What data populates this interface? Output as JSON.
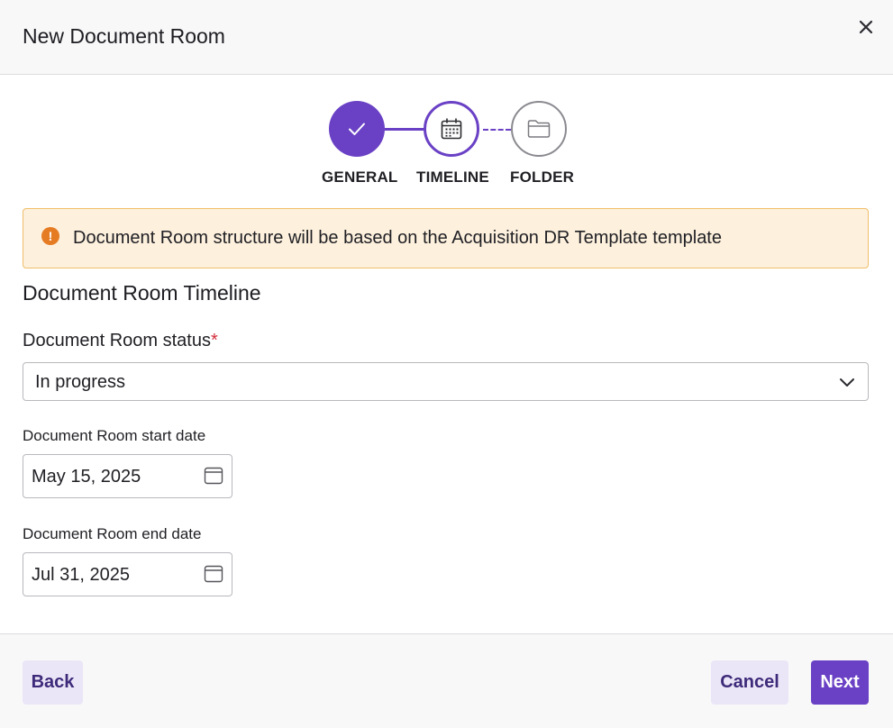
{
  "dialog": {
    "title": "New Document Room"
  },
  "stepper": {
    "steps": [
      {
        "label": "GENERAL",
        "state": "completed",
        "icon": "check-icon"
      },
      {
        "label": "TIMELINE",
        "state": "current",
        "icon": "calendar-icon"
      },
      {
        "label": "FOLDER",
        "state": "upcoming",
        "icon": "folder-icon"
      }
    ]
  },
  "alert": {
    "icon": "warning-icon",
    "icon_glyph": "!",
    "text": "Document Room structure will be based on the Acquisition DR Template template"
  },
  "section": {
    "title": "Document Room Timeline"
  },
  "form": {
    "status": {
      "label": "Document Room status",
      "required_mark": "*",
      "value": "In progress"
    },
    "start_date": {
      "label": "Document Room start date",
      "value": "May 15, 2025"
    },
    "end_date": {
      "label": "Document Room end date",
      "value": "Jul 31, 2025"
    }
  },
  "footer": {
    "back_label": "Back",
    "cancel_label": "Cancel",
    "next_label": "Next"
  },
  "colors": {
    "accent": "#6a41c5",
    "alert_bg": "#fdf0dd",
    "alert_border": "#f0be6a",
    "alert_icon": "#e57c23",
    "required": "#d12d3b"
  }
}
